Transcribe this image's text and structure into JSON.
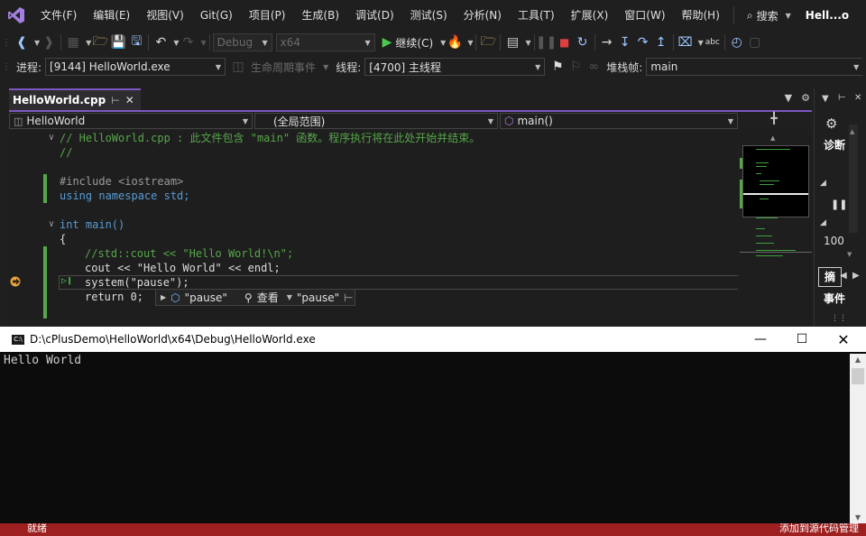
{
  "menu": {
    "items": [
      "文件(F)",
      "编辑(E)",
      "视图(V)",
      "Git(G)",
      "项目(P)",
      "生成(B)",
      "调试(D)",
      "测试(S)",
      "分析(N)",
      "工具(T)",
      "扩展(X)",
      "窗口(W)",
      "帮助(H)"
    ],
    "search_label": "搜索",
    "window_title": "Hell...o"
  },
  "toolbar": {
    "config": "Debug",
    "platform": "x64",
    "continue_label": "继续(C)"
  },
  "debugbar": {
    "process_label": "进程:",
    "process_value": "[9144] HelloWorld.exe",
    "lifecycle_label": "生命周期事件",
    "thread_label": "线程:",
    "thread_value": "[4700] 主线程",
    "stackframe_label": "堆栈帧:",
    "stackframe_value": "main"
  },
  "editor": {
    "tab_title": "HelloWorld.cpp",
    "nav_project": "HelloWorld",
    "nav_scope": "(全局范围)",
    "nav_member": "main()",
    "code_lines": [
      "// HelloWorld.cpp : 此文件包含 \"main\" 函数。程序执行将在此处开始并结束。",
      "//",
      "#include <iostream>",
      "using namespace std;",
      "int main()",
      "{",
      "//std::cout << \"Hello World!\\n\";",
      "cout << \"Hello World\" << endl;",
      "system(\"pause\");",
      "return 0;"
    ],
    "datatip": {
      "value": "\"pause\"",
      "view_label": "查看",
      "value2": "\"pause\""
    }
  },
  "rpanel": {
    "diag_label": "诊断",
    "number": "100",
    "summary_label": "摘",
    "events_label": "事件"
  },
  "console": {
    "title": "D:\\cPlusDemo\\HelloWorld\\x64\\Debug\\HelloWorld.exe",
    "output": "Hello World"
  },
  "statusbar": {
    "left": "就绪",
    "right": "添加到源代码管理"
  },
  "colors": {
    "accent": "#7e57c2",
    "status_bar": "#9e1f1f",
    "comment": "#57a64a",
    "keyword": "#569cd6",
    "string": "#d69d85"
  }
}
